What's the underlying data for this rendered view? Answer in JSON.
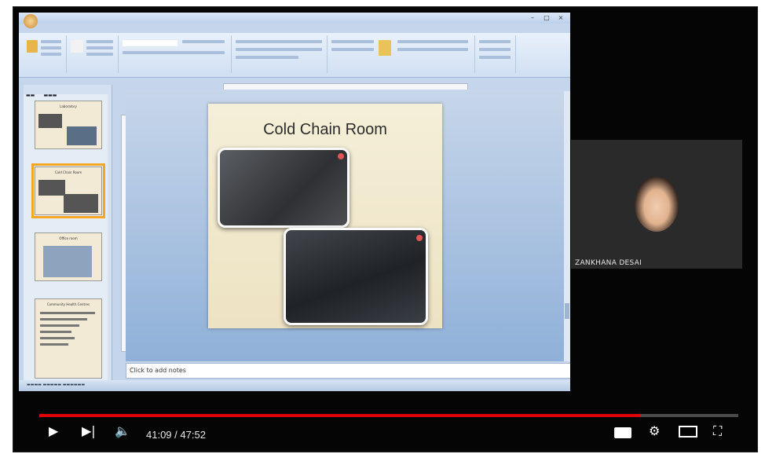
{
  "video": {
    "progress_fraction": 0.86,
    "time_current": "41:09",
    "time_separator": " / ",
    "time_total": "47:52",
    "controls": {
      "play_icon": "play-icon",
      "next_icon": "next-icon",
      "volume_icon": "volume-icon",
      "subtitles_icon": "subtitles-icon",
      "settings_icon": "settings-icon",
      "miniplayer_icon": "miniplayer-icon",
      "fullscreen_icon": "fullscreen-icon"
    },
    "accent_color": "#e00000"
  },
  "ppt": {
    "slide_title": "Cold Chain Room",
    "notes_placeholder": "Click to add notes",
    "thumbnails": [
      {
        "title": "Laboratory"
      },
      {
        "title": "Cold Chain Room"
      },
      {
        "title": "Office room"
      },
      {
        "title": "Community Health Centres"
      }
    ]
  },
  "participant": {
    "name": "ZANKHANA DESAI"
  }
}
